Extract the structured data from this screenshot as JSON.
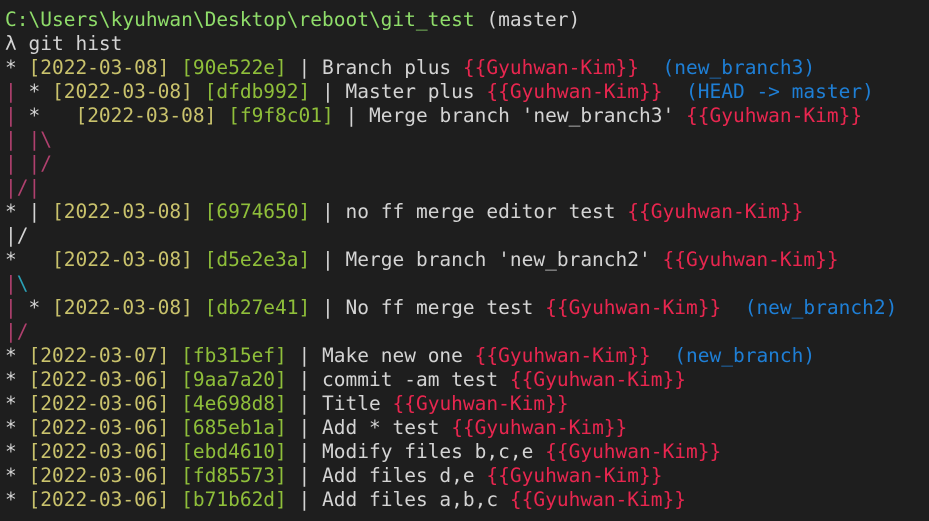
{
  "prompt": {
    "path": "C:\\Users\\kyuhwan\\Desktop\\reboot\\git_test",
    "branch": " (master)",
    "symbol": "λ",
    "command": " git hist"
  },
  "colors": {
    "path": "#8fdd6a",
    "date": "#c9c26c",
    "hash": "#8fbf3a",
    "author": "#e8264f",
    "ref": "#1e7fd6",
    "graph_pink": "#b0406e",
    "graph_cyan": "#2aa0b5"
  },
  "lines": [
    {
      "type": "commit",
      "graph": [
        {
          "t": "* ",
          "c": "white"
        }
      ],
      "date": "[2022-03-08]",
      "hash": "[90e522e]",
      "msg": "Branch plus",
      "author": "{{Gyuhwan-Kim}}",
      "ref": "(new_branch3)"
    },
    {
      "type": "commit",
      "graph": [
        {
          "t": "| ",
          "c": "pink"
        },
        {
          "t": "* ",
          "c": "white"
        }
      ],
      "date": "[2022-03-08]",
      "hash": "[dfdb992]",
      "msg": "Master plus",
      "author": "{{Gyuhwan-Kim}}",
      "ref": "(HEAD -> master)"
    },
    {
      "type": "commit",
      "graph": [
        {
          "t": "| ",
          "c": "pink"
        },
        {
          "t": "*   ",
          "c": "white"
        }
      ],
      "date": "[2022-03-08]",
      "hash": "[f9f8c01]",
      "msg": "Merge branch 'new_branch3'",
      "author": "{{Gyuhwan-Kim}}",
      "ref": ""
    },
    {
      "type": "graph",
      "graph": [
        {
          "t": "| ",
          "c": "pink"
        },
        {
          "t": "|",
          "c": "pink"
        },
        {
          "t": "\\",
          "c": "pink"
        }
      ]
    },
    {
      "type": "graph",
      "graph": [
        {
          "t": "| ",
          "c": "pink"
        },
        {
          "t": "|",
          "c": "pink"
        },
        {
          "t": "/",
          "c": "pink"
        }
      ]
    },
    {
      "type": "graph",
      "graph": [
        {
          "t": "|",
          "c": "pink"
        },
        {
          "t": "/",
          "c": "pink"
        },
        {
          "t": "|",
          "c": "pink"
        }
      ]
    },
    {
      "type": "commit",
      "graph": [
        {
          "t": "* ",
          "c": "white"
        },
        {
          "t": "| ",
          "c": "white"
        }
      ],
      "date": "[2022-03-08]",
      "hash": "[6974650]",
      "msg": "no ff merge editor test",
      "author": "{{Gyuhwan-Kim}}",
      "ref": ""
    },
    {
      "type": "graph",
      "graph": [
        {
          "t": "|",
          "c": "white"
        },
        {
          "t": "/",
          "c": "white"
        }
      ]
    },
    {
      "type": "commit",
      "graph": [
        {
          "t": "*   ",
          "c": "white"
        }
      ],
      "date": "[2022-03-08]",
      "hash": "[d5e2e3a]",
      "msg": "Merge branch 'new_branch2'",
      "author": "{{Gyuhwan-Kim}}",
      "ref": ""
    },
    {
      "type": "graph",
      "graph": [
        {
          "t": "|",
          "c": "pink"
        },
        {
          "t": "\\",
          "c": "cyan"
        }
      ]
    },
    {
      "type": "commit",
      "graph": [
        {
          "t": "| ",
          "c": "pink"
        },
        {
          "t": "* ",
          "c": "white"
        }
      ],
      "date": "[2022-03-08]",
      "hash": "[db27e41]",
      "msg": "No ff merge test",
      "author": "{{Gyuhwan-Kim}}",
      "ref": "(new_branch2)"
    },
    {
      "type": "graph",
      "graph": [
        {
          "t": "|",
          "c": "pink"
        },
        {
          "t": "/",
          "c": "pink"
        }
      ]
    },
    {
      "type": "commit",
      "graph": [
        {
          "t": "* ",
          "c": "white"
        }
      ],
      "date": "[2022-03-07]",
      "hash": "[fb315ef]",
      "msg": "Make new one",
      "author": "{{Gyuhwan-Kim}}",
      "ref": "(new_branch)"
    },
    {
      "type": "commit",
      "graph": [
        {
          "t": "* ",
          "c": "white"
        }
      ],
      "date": "[2022-03-06]",
      "hash": "[9aa7a20]",
      "msg": "commit -am test",
      "author": "{{Gyuhwan-Kim}}",
      "ref": ""
    },
    {
      "type": "commit",
      "graph": [
        {
          "t": "* ",
          "c": "white"
        }
      ],
      "date": "[2022-03-06]",
      "hash": "[4e698d8]",
      "msg": "Title",
      "author": "{{Gyuhwan-Kim}}",
      "ref": ""
    },
    {
      "type": "commit",
      "graph": [
        {
          "t": "* ",
          "c": "white"
        }
      ],
      "date": "[2022-03-06]",
      "hash": "[685eb1a]",
      "msg": "Add * test",
      "author": "{{Gyuhwan-Kim}}",
      "ref": ""
    },
    {
      "type": "commit",
      "graph": [
        {
          "t": "* ",
          "c": "white"
        }
      ],
      "date": "[2022-03-06]",
      "hash": "[ebd4610]",
      "msg": "Modify files b,c,e",
      "author": "{{Gyuhwan-Kim}}",
      "ref": ""
    },
    {
      "type": "commit",
      "graph": [
        {
          "t": "* ",
          "c": "white"
        }
      ],
      "date": "[2022-03-06]",
      "hash": "[fd85573]",
      "msg": "Add files d,e",
      "author": "{{Gyuhwan-Kim}}",
      "ref": ""
    },
    {
      "type": "commit",
      "graph": [
        {
          "t": "* ",
          "c": "white"
        }
      ],
      "date": "[2022-03-06]",
      "hash": "[b71b62d]",
      "msg": "Add files a,b,c",
      "author": "{{Gyuhwan-Kim}}",
      "ref": ""
    }
  ]
}
